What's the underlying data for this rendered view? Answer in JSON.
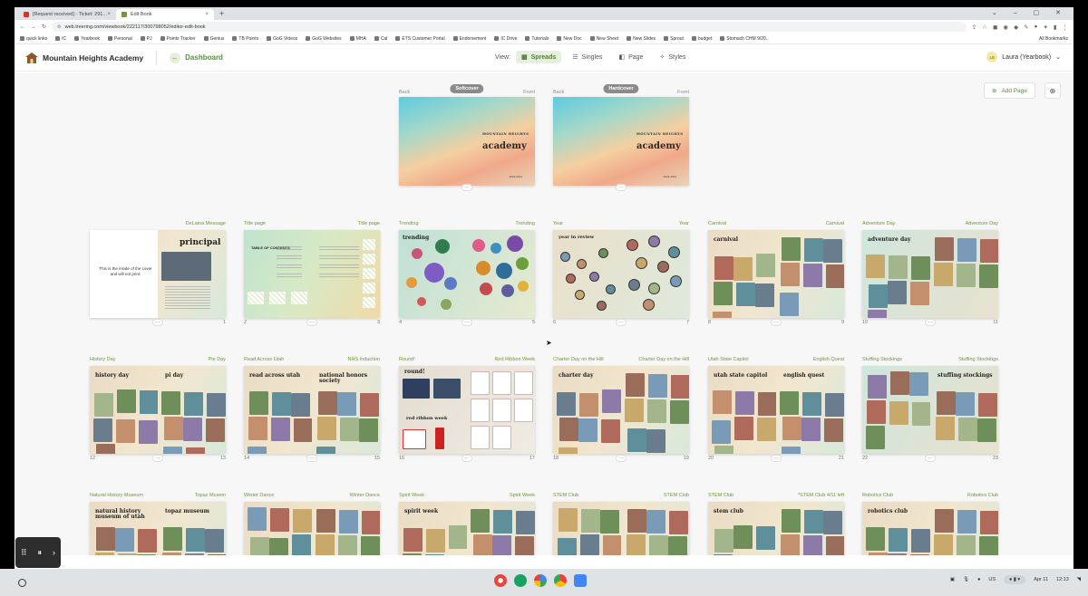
{
  "browser": {
    "tabs": [
      {
        "label": "[Request received] - Ticket: 291...",
        "active": false,
        "color": "#d93025"
      },
      {
        "label": "Edit Book",
        "active": true,
        "color": "#6c9b3a"
      }
    ],
    "url": "web.treering.com/viewbook/222117/300798052/editor-edit-book",
    "bookmarks": [
      "quick links",
      "IC",
      "Yearbook",
      "Personal",
      "PJ",
      "Points Tracker",
      "Genius",
      "TB Points",
      "GoG Videos",
      "GoG Websites",
      "MHA",
      "Cal",
      "ETS Customer Portal",
      "Endorsement",
      "IC Drive",
      "Tutorials",
      "New Doc",
      "New Sheet",
      "New Slides",
      "Sprout",
      "budget",
      "Stomach CHM 9/20.."
    ],
    "all_bookmarks": "All Bookmarks"
  },
  "header": {
    "school": "Mountain Heights Academy",
    "dashboard": "Dashboard",
    "view_label": "View:",
    "views": [
      "Spreads",
      "Singles",
      "Page",
      "Styles"
    ],
    "active_view": "Spreads",
    "user": "Laura (Yearbook)",
    "user_initials": "LB"
  },
  "toolbar": {
    "add_page": "Add Page"
  },
  "covers": [
    {
      "badge": "Softcover",
      "back": "Back",
      "front": "Front",
      "title_small": "MOUNTAIN HEIGHTS",
      "title_big": "academy",
      "year": "2023-2024"
    },
    {
      "badge": "Hardcover",
      "back": "Back",
      "front": "Front",
      "title_small": "MOUNTAIN HEIGHTS",
      "title_big": "academy",
      "year": "2023-2024"
    }
  ],
  "spreads": [
    {
      "left": "",
      "right": "DeLaina Message",
      "lnum": "",
      "rnum": "1",
      "theme": "principal",
      "ltext": "This is the inside of the cover and will not print.",
      "rtitle": "principal"
    },
    {
      "left": "Title page",
      "right": "Title page",
      "lnum": "2",
      "rnum": "3",
      "theme": "toc",
      "ltitle": "TABLE OF CONTENTS"
    },
    {
      "left": "Trending",
      "right": "Trending",
      "lnum": "4",
      "rnum": "5",
      "theme": "circles",
      "ltitle": "trending"
    },
    {
      "left": "Year",
      "right": "Year",
      "lnum": "6",
      "rnum": "7",
      "theme": "year",
      "ltitle": "year in review"
    },
    {
      "left": "Carnival",
      "right": "Carnival",
      "lnum": "8",
      "rnum": "9",
      "theme": "photos",
      "ltitle": "carnival"
    },
    {
      "left": "Adventure Day",
      "right": "Adventure Day",
      "lnum": "10",
      "rnum": "11",
      "theme": "photos2",
      "ltitle": "adventure day"
    },
    {
      "left": "History Day",
      "right": "Pie Day",
      "lnum": "12",
      "rnum": "13",
      "theme": "photos",
      "ltitle": "history day",
      "rtitle": "pi day"
    },
    {
      "left": "Read Across Utah",
      "right": "NHS Induction",
      "lnum": "14",
      "rnum": "15",
      "theme": "photos",
      "ltitle": "read across utah",
      "rtitle": "national honors society"
    },
    {
      "left": "Round!",
      "right": "Red Ribbon Week",
      "lnum": "16",
      "rnum": "17",
      "theme": "ribbon",
      "ltitle": "round!",
      "rtitle": "red ribbon week"
    },
    {
      "left": "Charter Day on the Hill",
      "right": "Charter Day on the Hill",
      "lnum": "18",
      "rnum": "19",
      "theme": "photos",
      "ltitle": "charter day"
    },
    {
      "left": "Utah State Capitol",
      "right": "English Quest",
      "lnum": "20",
      "rnum": "21",
      "theme": "photos",
      "ltitle": "utah state capitol",
      "rtitle": "english quest"
    },
    {
      "left": "Stuffing Stockings",
      "right": "Stuffing Stockings",
      "lnum": "22",
      "rnum": "23",
      "theme": "photos2",
      "rtitle": "stuffing stockings"
    },
    {
      "left": "Natural History Museum",
      "right": "Topaz Musem",
      "lnum": "",
      "rnum": "",
      "theme": "photos",
      "ltitle": "natural history museum of utah",
      "rtitle": "topaz museum"
    },
    {
      "left": "Winter Dance",
      "right": "Winter Dance",
      "lnum": "",
      "rnum": "",
      "theme": "photos",
      "ltitle": ""
    },
    {
      "left": "Spirit Week",
      "right": "Spirit Week",
      "lnum": "",
      "rnum": "",
      "theme": "photos",
      "ltitle": "spirit week"
    },
    {
      "left": "STEM Club",
      "right": "STEM Club",
      "lnum": "",
      "rnum": "",
      "theme": "photos",
      "ltitle": ""
    },
    {
      "left": "STEM Club",
      "right": "*STEM Club 4/11 left",
      "lnum": "",
      "rnum": "",
      "theme": "photos",
      "ltitle": "stem club"
    },
    {
      "left": "Robotics Club",
      "right": "Robotics Club",
      "lnum": "",
      "rnum": "",
      "theme": "photos",
      "ltitle": "robotics club"
    }
  ],
  "tray": {
    "lang": "US",
    "date": "Apr 11",
    "time": "12:13"
  },
  "colors": {
    "accent": "#5a8f3c",
    "label_green": "#6b9b2f"
  }
}
